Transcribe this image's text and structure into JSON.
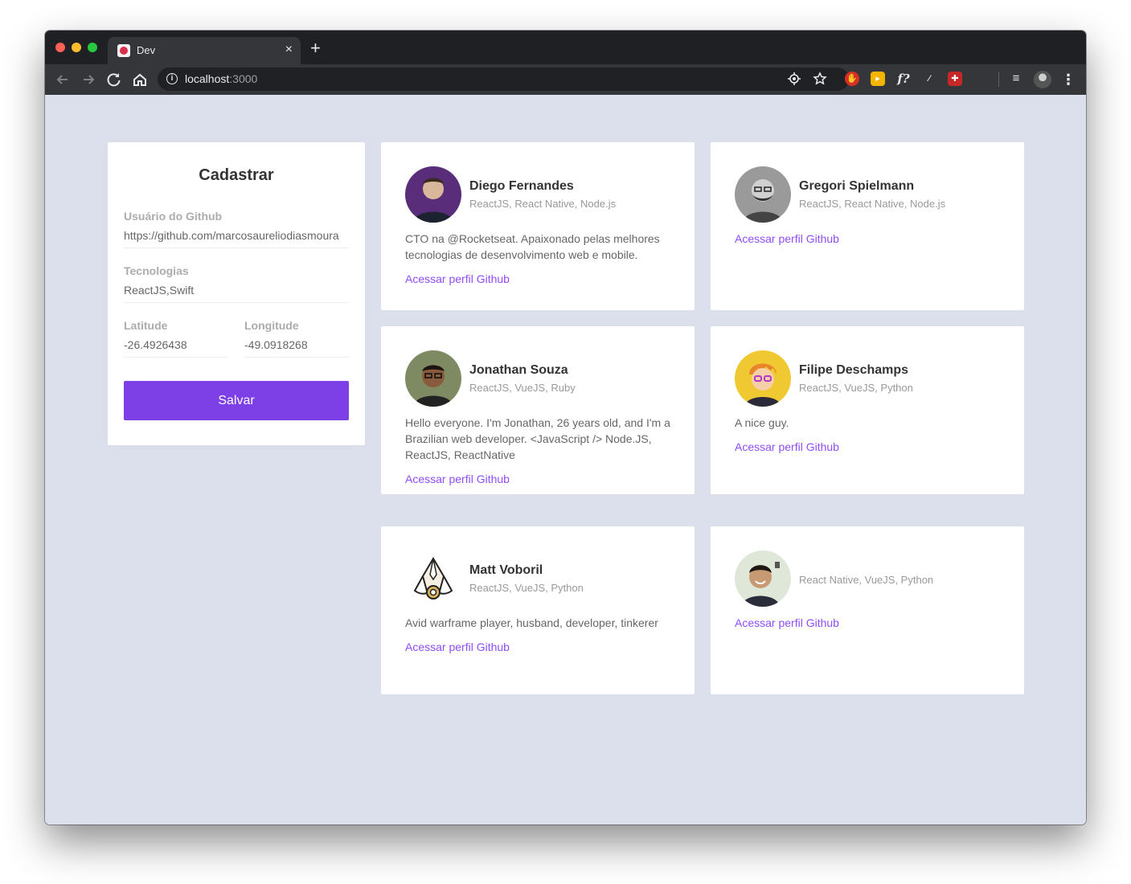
{
  "browser": {
    "tab_title": "Dev",
    "tab_close": "×",
    "new_tab": "+",
    "url_host": "localhost",
    "url_port": ":3000",
    "icons": [
      "back-icon",
      "forward-icon",
      "reload-icon",
      "home-icon",
      "info-icon",
      "location-icon",
      "star-icon",
      "menu-dots-icon"
    ]
  },
  "form": {
    "title": "Cadastrar",
    "github_label": "Usuário do Github",
    "github_value": "https://github.com/marcosaureliodiasmoura",
    "techs_label": "Tecnologias",
    "techs_value": "ReactJS,Swift",
    "latitude_label": "Latitude",
    "latitude_value": "-26.4926438",
    "longitude_label": "Longitude",
    "longitude_value": "-49.0918268",
    "submit_label": "Salvar"
  },
  "devs": [
    {
      "name": "Diego Fernandes",
      "techs": "ReactJS, React Native, Node.js",
      "bio": "CTO na @Rocketseat. Apaixonado pelas melhores tecnologias de desenvolvimento web e mobile.",
      "link": "Acessar perfil Github"
    },
    {
      "name": "Gregori Spielmann",
      "techs": "ReactJS, React Native, Node.js",
      "bio": "",
      "link": "Acessar perfil Github"
    },
    {
      "name": "Jonathan Souza",
      "techs": "ReactJS, VueJS, Ruby",
      "bio": "Hello everyone. I'm Jonathan, 26 years old, and I'm a Brazilian web developer. <JavaScript /> Node.JS, ReactJS, ReactNative",
      "link": "Acessar perfil Github"
    },
    {
      "name": "Filipe Deschamps",
      "techs": "ReactJS, VueJS, Python",
      "bio": "A nice guy.",
      "link": "Acessar perfil Github"
    },
    {
      "name": "Matt Voboril",
      "techs": "ReactJS, VueJS, Python",
      "bio": "Avid warframe player, husband, developer, tinkerer",
      "link": "Acessar perfil Github"
    },
    {
      "name": "",
      "techs": "React Native, VueJS, Python",
      "bio": "",
      "link": "Acessar perfil Github"
    }
  ],
  "colors": {
    "background": "#dcdfec",
    "accent": "#7d40e7",
    "link": "#8e4dff"
  }
}
